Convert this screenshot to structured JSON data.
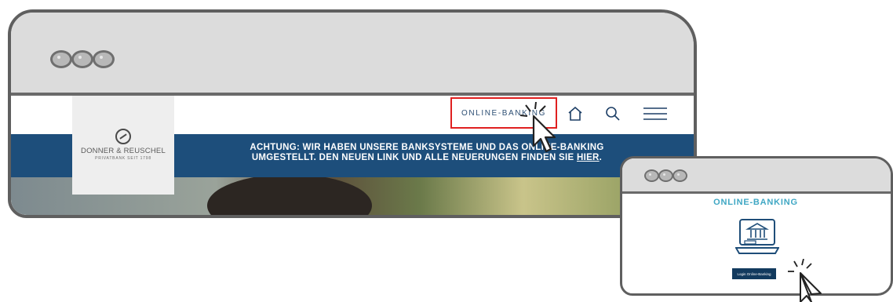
{
  "main_window": {
    "site": {
      "logo": {
        "name": "DONNER & REUSCHEL",
        "tagline": "PRIVATBANK SEIT 1798"
      },
      "nav": {
        "online_banking_label": "ONLINE-BANKING",
        "home_icon": "home-icon",
        "search_icon": "search-icon",
        "menu_icon": "hamburger-menu-icon"
      },
      "banner": {
        "line1": "ACHTUNG: WIR HABEN UNSERE BANKSYSTEME UND DAS ONLINE-BANKING",
        "line2_prefix": "UMGESTELLT. DEN NEUEN LINK UND ALLE NEUERUNGEN FINDEN SIE ",
        "link": "HIER",
        "line2_suffix": "."
      }
    }
  },
  "small_window": {
    "title": "ONLINE-BANKING",
    "icon": "online-banking-laptop-icon",
    "button_label": "Login Online-Banking"
  },
  "colors": {
    "banner_blue": "#1d4e7b",
    "highlight_red": "#e02020",
    "title_teal": "#3fa7c4",
    "button_navy": "#123a5e"
  }
}
